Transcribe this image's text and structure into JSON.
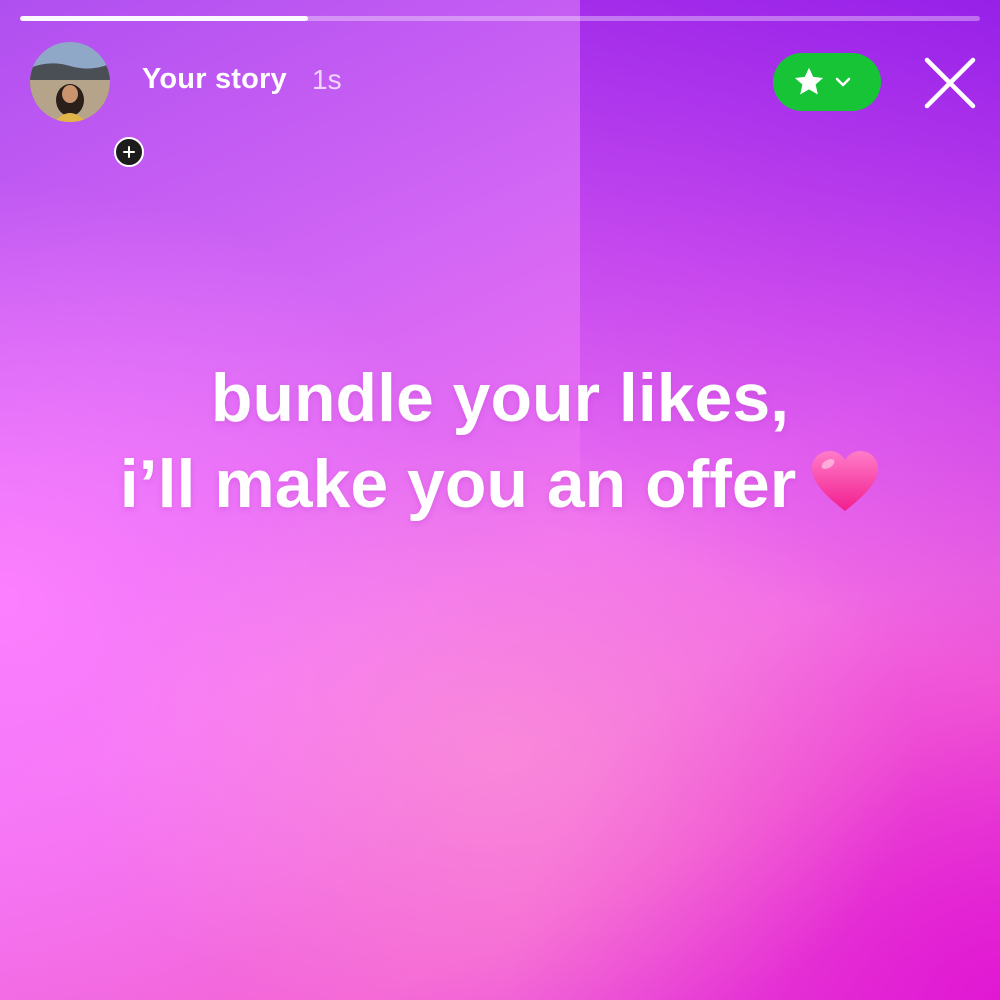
{
  "story": {
    "progress": 0.3,
    "username": "Your story",
    "time_ago": "1s",
    "caption_lines": [
      "bundle your likes,",
      "i’ll make you an offer"
    ],
    "audience_icon": "star-icon",
    "colors": {
      "audience_green": "#16c436",
      "gradient_top": "#b04ff0",
      "gradient_bottom": "#e13bd8",
      "heart": "#ff3fa8"
    }
  }
}
